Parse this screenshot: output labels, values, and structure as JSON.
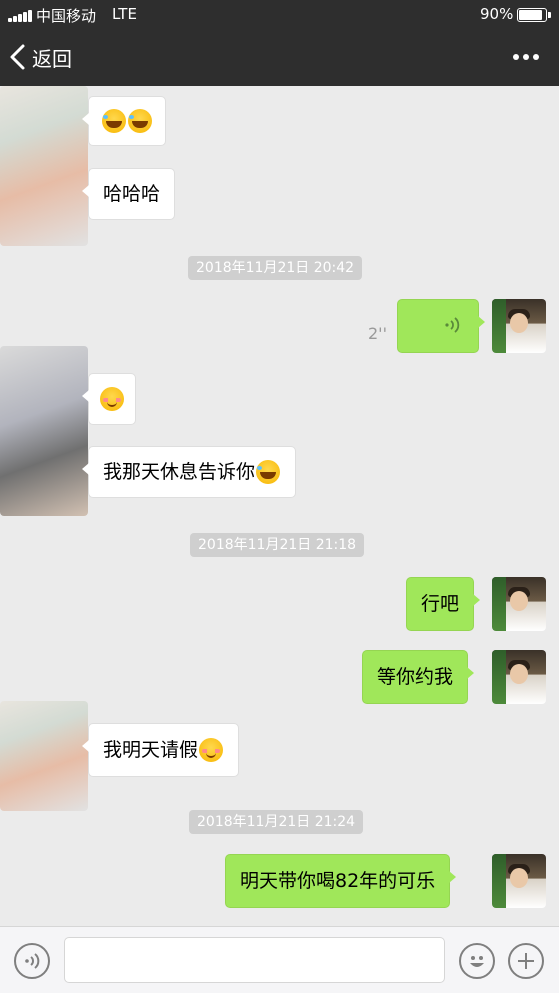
{
  "status_bar": {
    "carrier": "中国移动",
    "network": "LTE",
    "battery": "90%",
    "battery_level": 0.9
  },
  "nav": {
    "back_label": "返回"
  },
  "messages": {
    "m1": "",
    "m2": "哈哈哈",
    "ts1": "2018年11月21日 20:42",
    "voice_duration": "2''",
    "m4": "",
    "m5": "我那天休息告诉你",
    "ts2": "2018年11月21日 21:18",
    "m6": "行吧",
    "m7": "等你约我",
    "m8": "我明天请假",
    "ts3": "2018年11月21日 21:24",
    "m9": "明天带你喝82年的可乐"
  },
  "input": {
    "placeholder": ""
  },
  "colors": {
    "topbar": "#2e2e2e",
    "background": "#ebebeb",
    "outgoing_bubble": "#a0e75a",
    "incoming_bubble": "#ffffff"
  },
  "icons": {
    "back": "chevron-left-icon",
    "more": "more-dots-icon",
    "voice": "voice-wave-icon",
    "emoji": "emoji-icon",
    "plus": "plus-icon"
  }
}
